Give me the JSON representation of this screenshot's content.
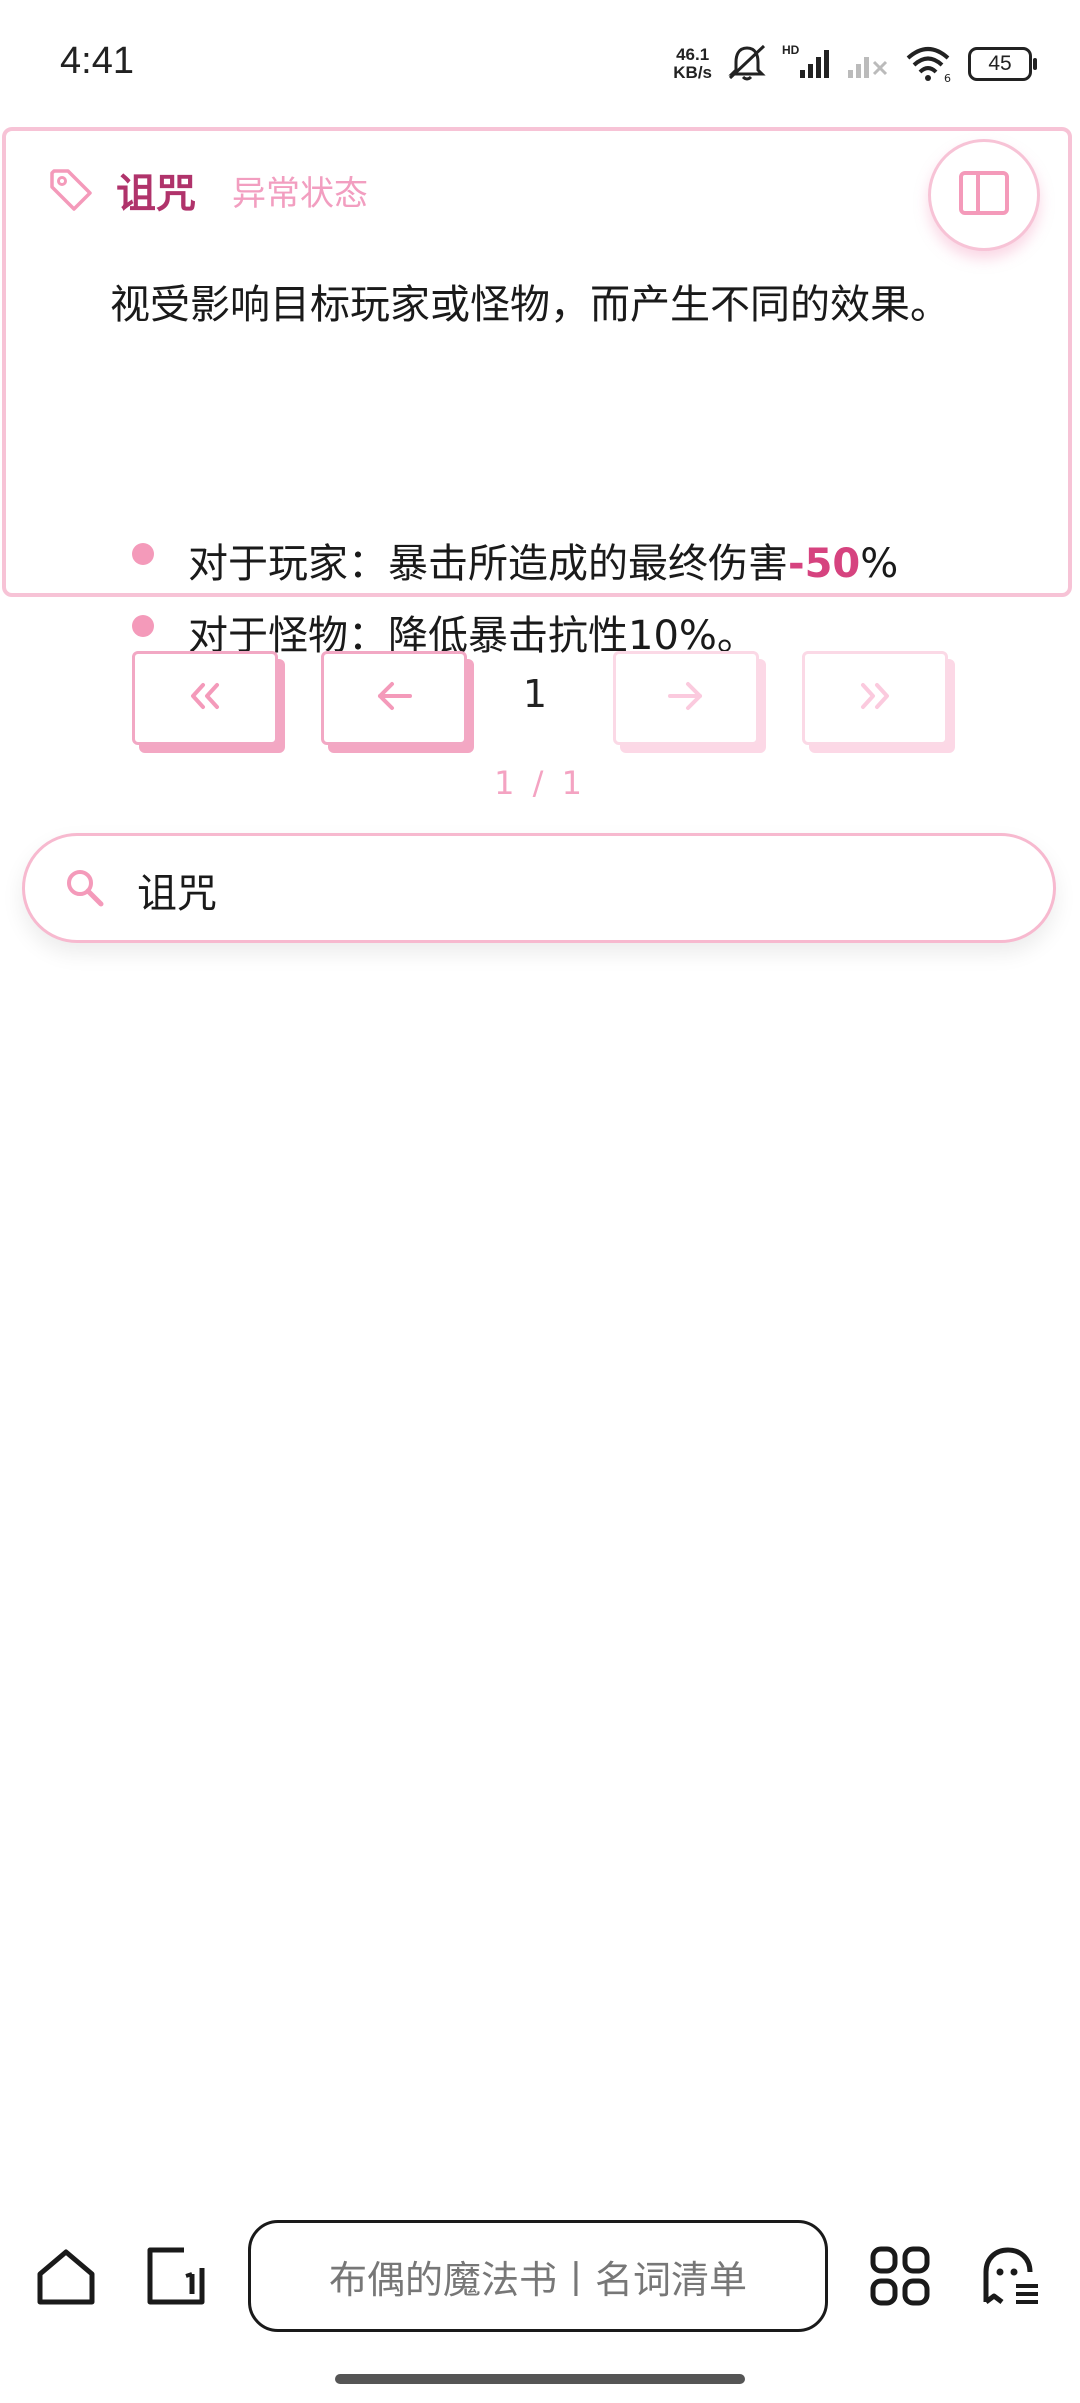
{
  "status_bar": {
    "time": "4:41",
    "net_speed_value": "46.1",
    "net_speed_unit": "KB/s",
    "battery": "45",
    "icons": [
      "mute-bell-icon",
      "hd-signal-icon",
      "no-signal-icon",
      "wifi-icon",
      "battery-icon"
    ]
  },
  "card": {
    "term": "诅咒",
    "category": "异常状态",
    "description": "视受影响目标玩家或怪物，而产生不同的效果。",
    "bullet1": {
      "prefix": "对于玩家：暴击所造成的最终伤害",
      "value": "-50",
      "suffix": "%"
    },
    "bullet2": "对于怪物：降低暴击抗性10%。",
    "toggle_icon": "sidebar-panel-icon",
    "tag_icon": "tag-icon"
  },
  "pagination": {
    "current_page": "1",
    "info": "1 / 1",
    "first_icon": "double-chevron-left-icon",
    "prev_icon": "arrow-left-icon",
    "next_icon": "arrow-right-icon",
    "last_icon": "double-chevron-right-icon"
  },
  "search": {
    "value": "诅咒",
    "icon": "search-icon"
  },
  "bottom_bar": {
    "address_text": "布偶的魔法书丨名词清单",
    "icons": [
      "home-icon",
      "tabs-icon",
      "apps-grid-icon",
      "ghost-menu-icon"
    ]
  },
  "colors": {
    "accent": "#f49aba",
    "term": "#b0336b",
    "border": "#f7c3d6"
  }
}
